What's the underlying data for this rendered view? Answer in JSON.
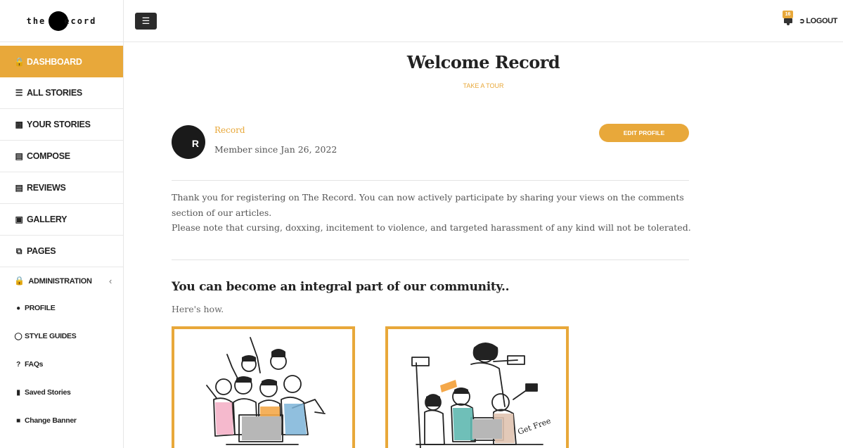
{
  "logo": {
    "left": "the",
    "right": "ecord"
  },
  "sidebar": {
    "items": [
      {
        "label": "DASHBOARD",
        "icon": "lock-icon",
        "active": true
      },
      {
        "label": "ALL STORIES",
        "icon": "list-icon"
      },
      {
        "label": "YOUR STORIES",
        "icon": "book-icon"
      },
      {
        "label": "COMPOSE",
        "icon": "document-icon"
      },
      {
        "label": "REVIEWS",
        "icon": "document-icon"
      },
      {
        "label": "GALLERY",
        "icon": "image-icon"
      },
      {
        "label": "PAGES",
        "icon": "copy-icon"
      }
    ],
    "admin": {
      "label": "ADMINISTRATION",
      "icon": "lock-icon",
      "chevron": "‹"
    },
    "sub_items": [
      {
        "label": "PROFILE",
        "icon": "user-icon"
      },
      {
        "label": "STYLE GUIDES",
        "icon": "chat-icon"
      },
      {
        "label": "FAQs",
        "icon": "question-icon"
      },
      {
        "label": "Saved Stories",
        "icon": "bookmark-icon"
      },
      {
        "label": "Change Banner",
        "icon": "square-icon"
      }
    ]
  },
  "topbar": {
    "menu_icon": "hamburger-icon",
    "notifications_count": "16",
    "logout_label": "LOGOUT"
  },
  "main": {
    "title": "Welcome Record",
    "tour_label": "TAKE A TOUR",
    "profile": {
      "avatar_letter": "R",
      "name": "Record",
      "member_since": "Member since Jan 26, 2022",
      "edit_label": "EDIT PROFILE"
    },
    "intro_line1": "Thank you for registering on The Record. You can now actively participate by sharing your views on the comments section of our articles.",
    "intro_line2": "Please note that cursing, doxxing, incitement to violence, and targeted harassment of any kind will not be tolerated.",
    "community_heading": "You can become an integral part of our community..",
    "howto": "Here's how.",
    "card2_sign": "Get Free"
  },
  "colors": {
    "accent": "#e8a83a",
    "dark": "#2b2b2b"
  }
}
